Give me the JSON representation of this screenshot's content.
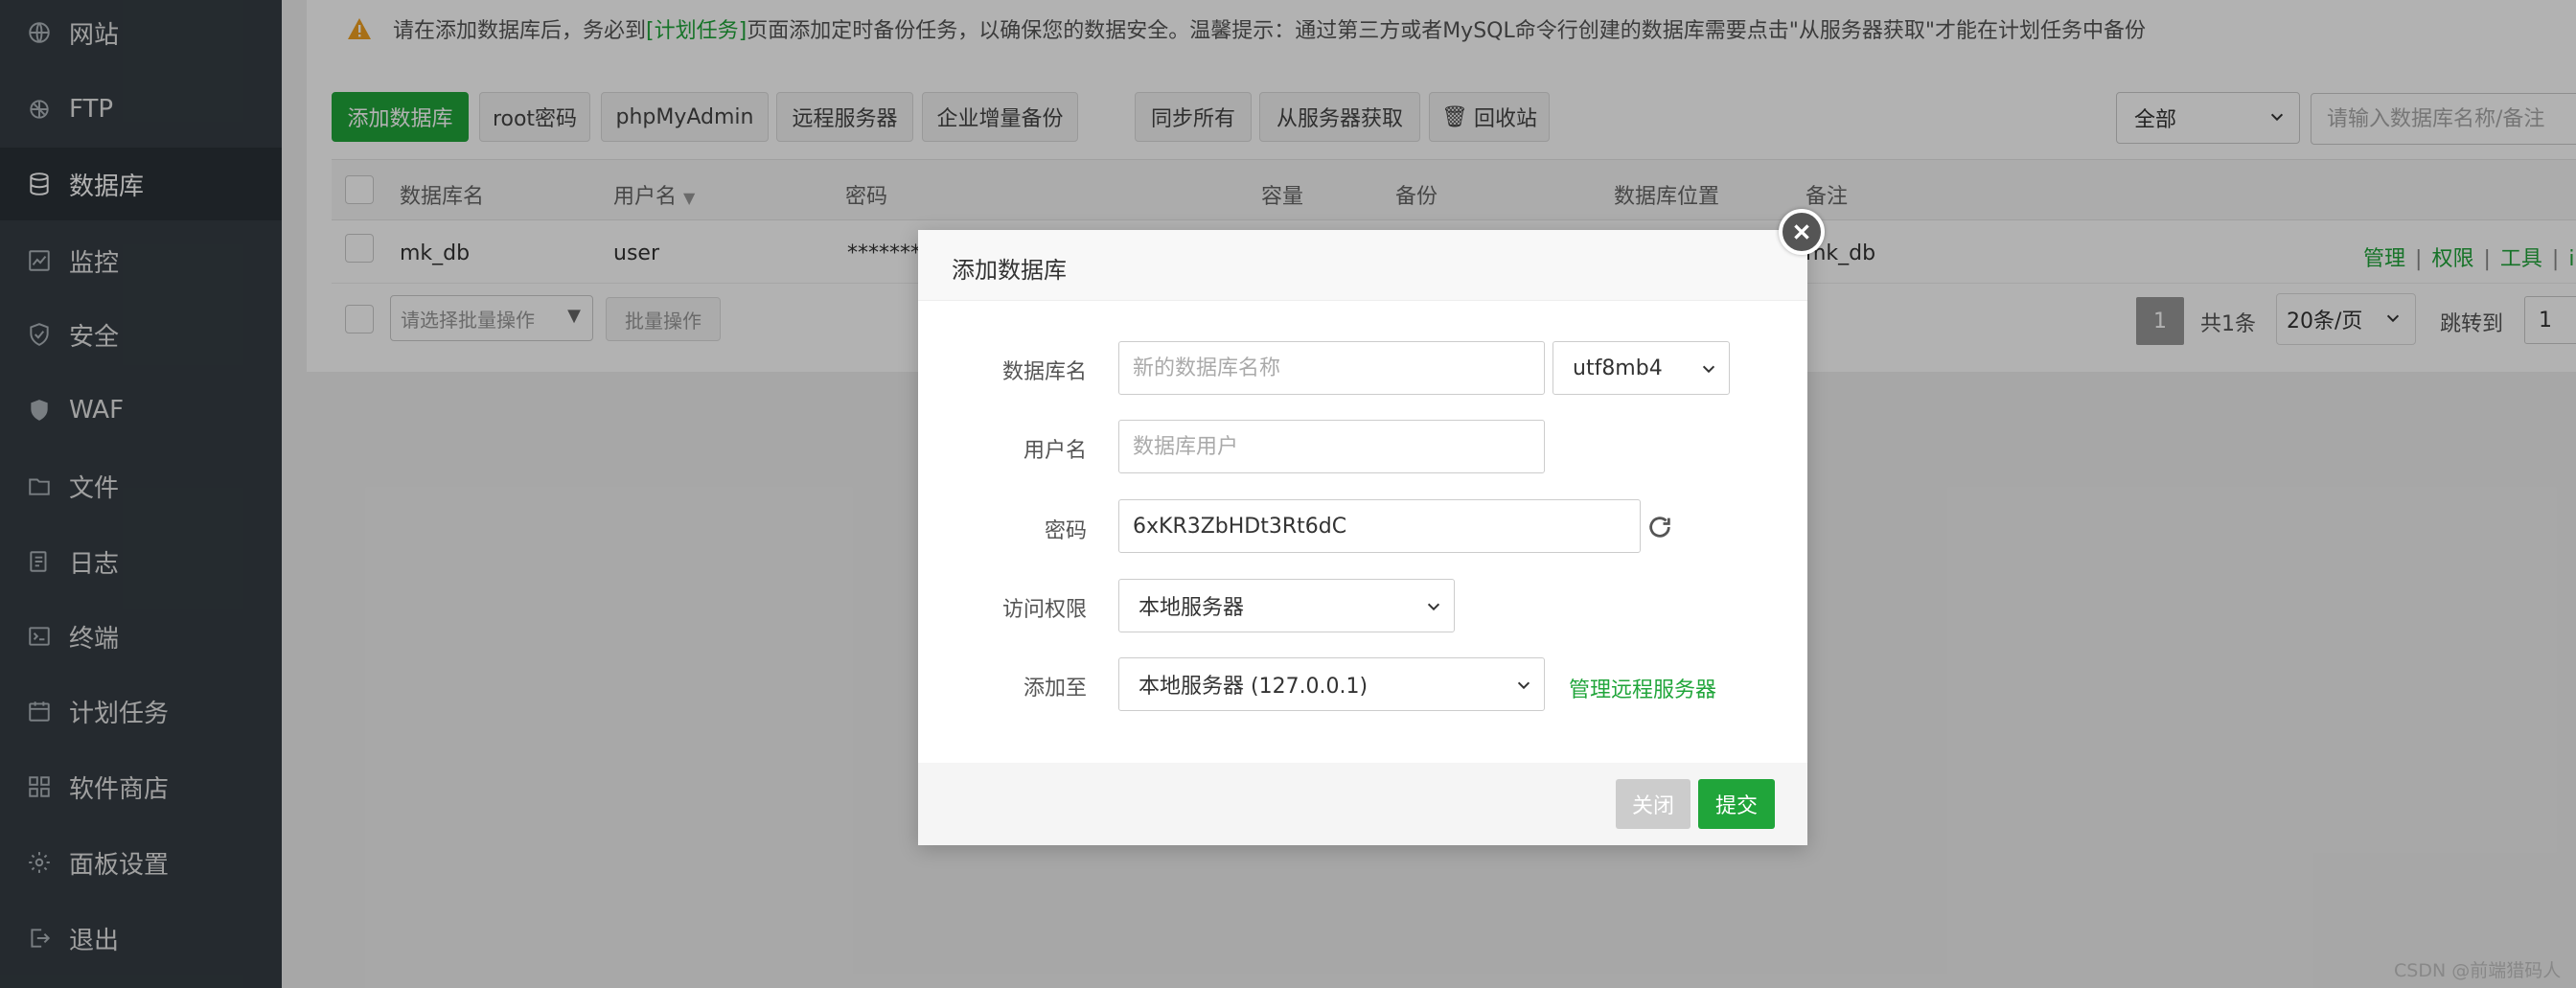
{
  "sidebar": {
    "items": [
      {
        "label": "网站",
        "icon": "globe-icon"
      },
      {
        "label": "FTP",
        "icon": "ftp-icon"
      },
      {
        "label": "数据库",
        "icon": "database-icon",
        "active": true
      },
      {
        "label": "监控",
        "icon": "monitor-icon"
      },
      {
        "label": "安全",
        "icon": "shield-icon"
      },
      {
        "label": "WAF",
        "icon": "waf-shield-icon"
      },
      {
        "label": "文件",
        "icon": "folder-icon"
      },
      {
        "label": "日志",
        "icon": "log-icon"
      },
      {
        "label": "终端",
        "icon": "terminal-icon"
      },
      {
        "label": "计划任务",
        "icon": "calendar-icon"
      },
      {
        "label": "软件商店",
        "icon": "apps-icon"
      },
      {
        "label": "面板设置",
        "icon": "gear-icon"
      },
      {
        "label": "退出",
        "icon": "logout-icon"
      }
    ]
  },
  "notice": {
    "prefix": "请在添加数据库后，务必到",
    "link": "[计划任务]",
    "suffix": "页面添加定时备份任务，以确保您的数据安全。温馨提示：通过第三方或者MySQL命令行创建的数据库需要点击\"从服务器获取\"才能在计划任务中备份"
  },
  "toolbar": {
    "add_db": "添加数据库",
    "root_pwd": "root密码",
    "phpmyadmin": "phpMyAdmin",
    "remote_server": "远程服务器",
    "enterprise_backup": "企业增量备份",
    "sync_all": "同步所有",
    "fetch_from_server": "从服务器获取",
    "recycle_bin": "回收站",
    "filter_value": "全部",
    "search_placeholder": "请输入数据库名称/备注"
  },
  "table": {
    "headers": {
      "name": "数据库名",
      "user": "用户名",
      "password": "密码",
      "capacity": "容量",
      "backup": "备份",
      "location": "数据库位置",
      "remark": "备注"
    },
    "row": {
      "name": "mk_db",
      "user": "user",
      "password": "**********",
      "remark": "mk_db",
      "ops": [
        "管理",
        "权限",
        "工具",
        "i"
      ]
    }
  },
  "batch": {
    "select_placeholder": "请选择批量操作",
    "button": "批量操作"
  },
  "pagination": {
    "current": "1",
    "total": "共1条",
    "per_page": "20条/页",
    "jump_label": "跳转到",
    "jump_value": "1"
  },
  "modal": {
    "title": "添加数据库",
    "db_name_label": "数据库名",
    "db_name_placeholder": "新的数据库名称",
    "charset": "utf8mb4",
    "username_label": "用户名",
    "username_placeholder": "数据库用户",
    "password_label": "密码",
    "password_value": "6xKR3ZbHDt3Rt6dC",
    "access_label": "访问权限",
    "access_value": "本地服务器",
    "add_to_label": "添加至",
    "add_to_value": "本地服务器 (127.0.0.1)",
    "manage_remote": "管理远程服务器",
    "close_btn": "关闭",
    "submit_btn": "提交"
  },
  "colors": {
    "accent": "#20a53a",
    "sidebar_bg": "#353d44",
    "sidebar_active": "#2a3137",
    "warning": "#f0a020"
  },
  "watermark": "CSDN @前端猎码人"
}
